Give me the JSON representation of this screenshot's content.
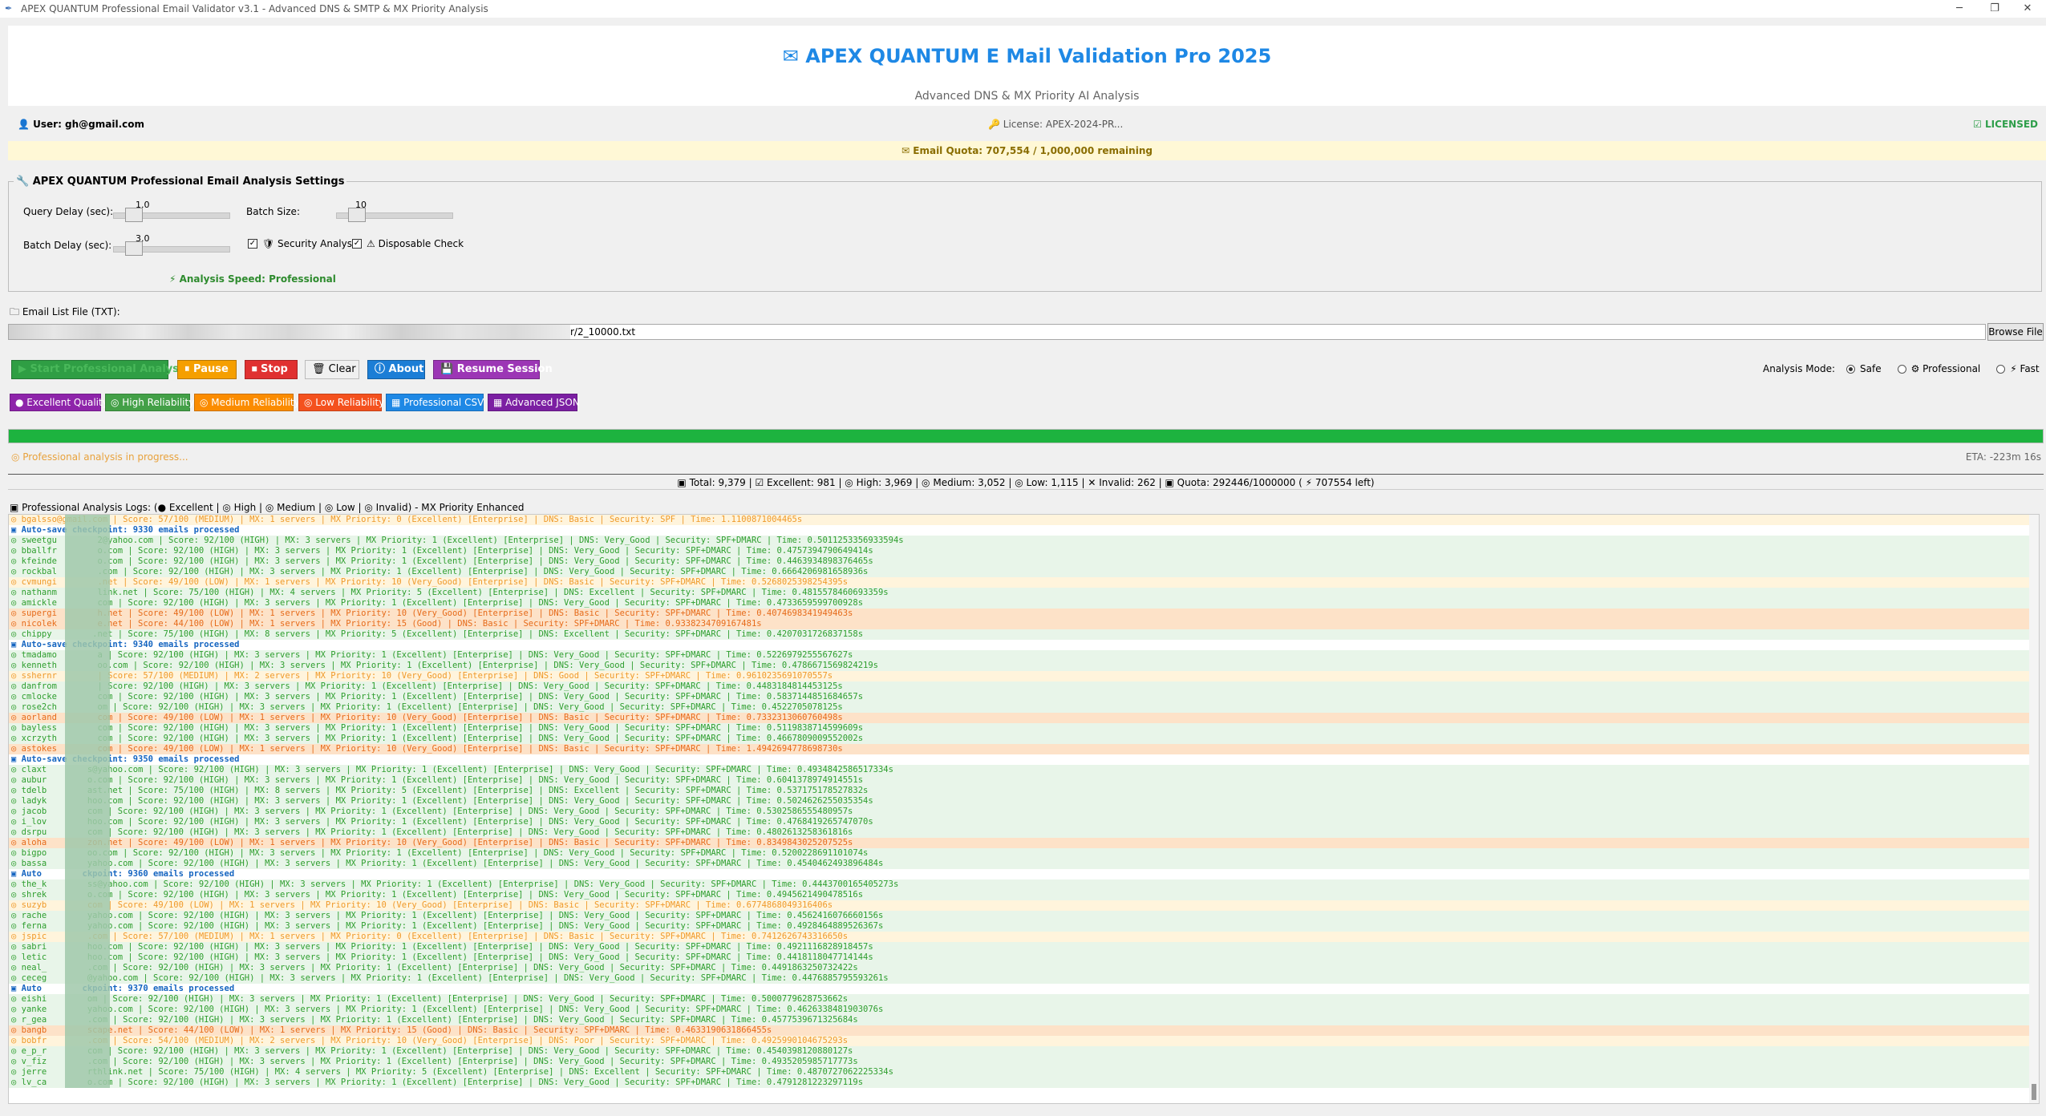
{
  "window": {
    "title": "APEX QUANTUM Professional Email Validator v3.1 - Advanced DNS & SMTP & MX Priority Analysis",
    "minimize": "─",
    "maximize": "❐",
    "close": "✕"
  },
  "header": {
    "title": "✉ APEX QUANTUM E Mail Validation Pro 2025",
    "subtitle": "Advanced DNS & MX Priority AI Analysis"
  },
  "userbar": {
    "user": "👤 User: gh@gmail.com",
    "license": "🔑 License: APEX-2024-PR...",
    "licensed": "☑ LICENSED"
  },
  "quota_bar": "✉ Email Quota: 707,554 / 1,000,000 remaining",
  "settings": {
    "title": "🔧 APEX QUANTUM Professional Email Analysis Settings",
    "query_delay_label": "Query Delay (sec):",
    "query_delay_value": "1.0",
    "query_delay_level": 0.09,
    "batch_size_label": "Batch Size:",
    "batch_size_value": "10",
    "batch_size_level": 0.09,
    "batch_delay_label": "Batch Delay (sec):",
    "batch_delay_value": "3.0",
    "batch_delay_level": 0.09,
    "security_analysis": "🛡 Security Analysis",
    "security_analysis_checked": true,
    "disposable_check": "⚠ Disposable Check",
    "disposable_check_checked": true,
    "analysis_speed": "⚡ Analysis Speed: Professional"
  },
  "file": {
    "label": "🗀 Email List File (TXT):",
    "path": "r/2_10000.txt",
    "browse": "Browse File"
  },
  "buttons": {
    "start": "▶ Start Professional Analysis",
    "pause": "⏸ Pause",
    "stop": "⏹ Stop",
    "clear": "🗑 Clear",
    "about": "ⓘ About",
    "resume": "💾 Resume Session"
  },
  "export_buttons": {
    "excellent": "● Excellent Quality",
    "high": "◎ High Reliability",
    "medium": "◎ Medium Reliability",
    "low": "◎ Low Reliability",
    "csv": "▦ Professional CSV",
    "json": "▦ Advanced JSON"
  },
  "mode": {
    "label": "Analysis Mode:",
    "safe": "Safe",
    "professional": "⚙ Professional",
    "fast": "⚡ Fast",
    "selected": "safe"
  },
  "progress": {
    "fraction": 1.0,
    "status": "◎ Professional analysis in progress...",
    "eta": "ETA: -223m 16s"
  },
  "stats": "▣ Total: 9,379 | ☑ Excellent: 981 | ◎ High: 3,969 | ◎ Medium: 3,052 | ◎ Low: 1,115 | ✕ Invalid: 262 | ▣ Quota: 292446/1000000 ( ⚡ 707554 left)",
  "logs": {
    "title": "▣ Professional Analysis Logs: (● Excellent | ◎ High | ◎ Medium | ◎ Low | ◎ Invalid) - MX Priority Enhanced",
    "lines": [
      {
        "t": "medium",
        "s": "◎ bgalsso@gmail.com | Score: 57/100 (MEDIUM) | MX: 1 servers | MX Priority: 0 (Excellent) [Enterprise] | DNS: Basic | Security: SPF | Time: 1.1100871004465s"
      },
      {
        "t": "cp",
        "s": "▣ Auto-save checkpoint: 9330 emails processed"
      },
      {
        "t": "high",
        "s": "◎ sweetgu        2@yahoo.com | Score: 92/100 (HIGH) | MX: 3 servers | MX Priority: 1 (Excellent) [Enterprise] | DNS: Very_Good | Security: SPF+DMARC | Time: 0.5011253356933594s"
      },
      {
        "t": "high",
        "s": "◎ bballfr        o.com | Score: 92/100 (HIGH) | MX: 3 servers | MX Priority: 1 (Excellent) [Enterprise] | DNS: Very_Good | Security: SPF+DMARC | Time: 0.4757394790649414s"
      },
      {
        "t": "high",
        "s": "◎ kfeinde        o.com | Score: 92/100 (HIGH) | MX: 3 servers | MX Priority: 1 (Excellent) [Enterprise] | DNS: Very_Good | Security: SPF+DMARC | Time: 0.4463934898376465s"
      },
      {
        "t": "high",
        "s": "◎ rockbal        .com | Score: 92/100 (HIGH) | MX: 3 servers | MX Priority: 1 (Excellent) [Enterprise] | DNS: Very_Good | Security: SPF+DMARC | Time: 0.6664206981658936s"
      },
      {
        "t": "medium",
        "s": "◎ cvmungi        .net | Score: 49/100 (LOW) | MX: 1 servers | MX Priority: 10 (Very_Good) [Enterprise] | DNS: Basic | Security: SPF+DMARC | Time: 0.5268025398254395s"
      },
      {
        "t": "high",
        "s": "◎ nathanm        link.net | Score: 75/100 (HIGH) | MX: 4 servers | MX Priority: 5 (Excellent) [Enterprise] | DNS: Excellent | Security: SPF+DMARC | Time: 0.4815578460693359s"
      },
      {
        "t": "high",
        "s": "◎ amickle        com | Score: 92/100 (HIGH) | MX: 3 servers | MX Priority: 1 (Excellent) [Enterprise] | DNS: Very_Good | Security: SPF+DMARC | Time: 0.4733659599700928s"
      },
      {
        "t": "low",
        "s": "◎ supergi        h.net | Score: 49/100 (LOW) | MX: 1 servers | MX Priority: 10 (Very_Good) [Enterprise] | DNS: Basic | Security: SPF+DMARC | Time: 0.4074698341949463s"
      },
      {
        "t": "low",
        "s": "◎ nicolek        e.net | Score: 44/100 (LOW) | MX: 1 servers | MX Priority: 15 (Good) | DNS: Basic | Security: SPF+DMARC | Time: 0.9338234709167481s"
      },
      {
        "t": "high",
        "s": "◎ chippy        .net | Score: 75/100 (HIGH) | MX: 8 servers | MX Priority: 5 (Excellent) [Enterprise] | DNS: Excellent | Security: SPF+DMARC | Time: 0.4207031726837158s"
      },
      {
        "t": "cp",
        "s": "▣ Auto-save checkpoint: 9340 emails processed"
      },
      {
        "t": "high",
        "s": "◎ tmadamo        a | Score: 92/100 (HIGH) | MX: 3 servers | MX Priority: 1 (Excellent) [Enterprise] | DNS: Very_Good | Security: SPF+DMARC | Time: 0.5226979255567627s"
      },
      {
        "t": "high",
        "s": "◎ kenneth        oo.com | Score: 92/100 (HIGH) | MX: 3 servers | MX Priority: 1 (Excellent) [Enterprise] | DNS: Very_Good | Security: SPF+DMARC | Time: 0.4786671569824219s"
      },
      {
        "t": "medium",
        "s": "◎ sshernr        | Score: 57/100 (MEDIUM) | MX: 2 servers | MX Priority: 10 (Very_Good) [Enterprise] | DNS: Good | Security: SPF+DMARC | Time: 0.9610235691070557s"
      },
      {
        "t": "high",
        "s": "◎ danfrom        | Score: 92/100 (HIGH) | MX: 3 servers | MX Priority: 1 (Excellent) [Enterprise] | DNS: Very_Good | Security: SPF+DMARC | Time: 0.4483184814453125s"
      },
      {
        "t": "high",
        "s": "◎ cmlocke        com | Score: 92/100 (HIGH) | MX: 3 servers | MX Priority: 1 (Excellent) [Enterprise] | DNS: Very_Good | Security: SPF+DMARC | Time: 0.5837144851684657s"
      },
      {
        "t": "high",
        "s": "◎ rose2ch        om | Score: 92/100 (HIGH) | MX: 3 servers | MX Priority: 1 (Excellent) [Enterprise] | DNS: Very_Good | Security: SPF+DMARC | Time: 0.4522705078125s"
      },
      {
        "t": "low",
        "s": "◎ aorland        com | Score: 49/100 (LOW) | MX: 1 servers | MX Priority: 10 (Very_Good) [Enterprise] | DNS: Basic | Security: SPF+DMARC | Time: 0.7332313060760498s"
      },
      {
        "t": "high",
        "s": "◎ bayless        com | Score: 92/100 (HIGH) | MX: 3 servers | MX Priority: 1 (Excellent) [Enterprise] | DNS: Very_Good | Security: SPF+DMARC | Time: 0.5119838714599609s"
      },
      {
        "t": "high",
        "s": "◎ xcrzyth        com | Score: 92/100 (HIGH) | MX: 3 servers | MX Priority: 1 (Excellent) [Enterprise] | DNS: Very_Good | Security: SPF+DMARC | Time: 0.4667809009552002s"
      },
      {
        "t": "low",
        "s": "◎ astokes        com | Score: 49/100 (LOW) | MX: 1 servers | MX Priority: 10 (Very_Good) [Enterprise] | DNS: Basic | Security: SPF+DMARC | Time: 1.4942694778698730s"
      },
      {
        "t": "cp",
        "s": "▣ Auto-save checkpoint: 9350 emails processed"
      },
      {
        "t": "high",
        "s": "◎ claxt        s@yahoo.com | Score: 92/100 (HIGH) | MX: 3 servers | MX Priority: 1 (Excellent) [Enterprise] | DNS: Very_Good | Security: SPF+DMARC | Time: 0.4934842586517334s"
      },
      {
        "t": "high",
        "s": "◎ aubur        o.com | Score: 92/100 (HIGH) | MX: 3 servers | MX Priority: 1 (Excellent) [Enterprise] | DNS: Very_Good | Security: SPF+DMARC | Time: 0.6041378974914551s"
      },
      {
        "t": "high",
        "s": "◎ tdelb        ast.net | Score: 75/100 (HIGH) | MX: 8 servers | MX Priority: 5 (Excellent) [Enterprise] | DNS: Excellent | Security: SPF+DMARC | Time: 0.537175178527832s"
      },
      {
        "t": "high",
        "s": "◎ ladyk        hoo.com | Score: 92/100 (HIGH) | MX: 3 servers | MX Priority: 1 (Excellent) [Enterprise] | DNS: Very_Good | Security: SPF+DMARC | Time: 0.5024626255035354s"
      },
      {
        "t": "high",
        "s": "◎ jacob        com | Score: 92/100 (HIGH) | MX: 3 servers | MX Priority: 1 (Excellent) [Enterprise] | DNS: Very_Good | Security: SPF+DMARC | Time: 0.5302586555480957s"
      },
      {
        "t": "high",
        "s": "◎ i_lov        hoo.com | Score: 92/100 (HIGH) | MX: 3 servers | MX Priority: 1 (Excellent) [Enterprise] | DNS: Very_Good | Security: SPF+DMARC | Time: 0.4768419265747070s"
      },
      {
        "t": "high",
        "s": "◎ dsrpu        com | Score: 92/100 (HIGH) | MX: 3 servers | MX Priority: 1 (Excellent) [Enterprise] | DNS: Very_Good | Security: SPF+DMARC | Time: 0.4802613258361816s"
      },
      {
        "t": "low",
        "s": "◎ aloha        zon.net | Score: 49/100 (LOW) | MX: 1 servers | MX Priority: 10 (Very_Good) [Enterprise] | DNS: Basic | Security: SPF+DMARC | Time: 0.8349843025207525s"
      },
      {
        "t": "high",
        "s": "◎ bigpo        oo.com | Score: 92/100 (HIGH) | MX: 3 servers | MX Priority: 1 (Excellent) [Enterprise] | DNS: Very_Good | Security: SPF+DMARC | Time: 0.5200228691101074s"
      },
      {
        "t": "high",
        "s": "◎ bassa        yahoo.com | Score: 92/100 (HIGH) | MX: 3 servers | MX Priority: 1 (Excellent) [Enterprise] | DNS: Very_Good | Security: SPF+DMARC | Time: 0.4540462493896484s"
      },
      {
        "t": "cp",
        "s": "▣ Auto        ckpoint: 9360 emails processed"
      },
      {
        "t": "high",
        "s": "◎ the_k        ss@yahoo.com | Score: 92/100 (HIGH) | MX: 3 servers | MX Priority: 1 (Excellent) [Enterprise] | DNS: Very_Good | Security: SPF+DMARC | Time: 0.4443700165405273s"
      },
      {
        "t": "high",
        "s": "◎ shrek        o.com | Score: 92/100 (HIGH) | MX: 3 servers | MX Priority: 1 (Excellent) [Enterprise] | DNS: Very_Good | Security: SPF+DMARC | Time: 0.4945621490478516s"
      },
      {
        "t": "medium",
        "s": "◎ suzyb        com | Score: 49/100 (LOW) | MX: 1 servers | MX Priority: 10 (Very_Good) [Enterprise] | DNS: Basic | Security: SPF+DMARC | Time: 0.6774868049316406s"
      },
      {
        "t": "high",
        "s": "◎ rache        yahoo.com | Score: 92/100 (HIGH) | MX: 3 servers | MX Priority: 1 (Excellent) [Enterprise] | DNS: Very_Good | Security: SPF+DMARC | Time: 0.4562416076660156s"
      },
      {
        "t": "high",
        "s": "◎ ferna        yahoo.com | Score: 92/100 (HIGH) | MX: 3 servers | MX Priority: 1 (Excellent) [Enterprise] | DNS: Very_Good | Security: SPF+DMARC | Time: 0.4928464889526367s"
      },
      {
        "t": "medium",
        "s": "◎ jspic        .com | Score: 57/100 (MEDIUM) | MX: 1 servers | MX Priority: 0 (Excellent) [Enterprise] | DNS: Basic | Security: SPF+DMARC | Time: 0.7412626743316650s"
      },
      {
        "t": "high",
        "s": "◎ sabri        hoo.com | Score: 92/100 (HIGH) | MX: 3 servers | MX Priority: 1 (Excellent) [Enterprise] | DNS: Very_Good | Security: SPF+DMARC | Time: 0.4921116828918457s"
      },
      {
        "t": "high",
        "s": "◎ letic        hoo.com | Score: 92/100 (HIGH) | MX: 3 servers | MX Priority: 1 (Excellent) [Enterprise] | DNS: Very_Good | Security: SPF+DMARC | Time: 0.4418118047714144s"
      },
      {
        "t": "high",
        "s": "◎ neal_        .com | Score: 92/100 (HIGH) | MX: 3 servers | MX Priority: 1 (Excellent) [Enterprise] | DNS: Very_Good | Security: SPF+DMARC | Time: 0.4491863250732422s"
      },
      {
        "t": "high",
        "s": "◎ ceceg        @yahoo.com | Score: 92/100 (HIGH) | MX: 3 servers | MX Priority: 1 (Excellent) [Enterprise] | DNS: Very_Good | Security: SPF+DMARC | Time: 0.4476885795593261s"
      },
      {
        "t": "cp",
        "s": "▣ Auto        ckpoint: 9370 emails processed"
      },
      {
        "t": "high",
        "s": "◎ eishi        om | Score: 92/100 (HIGH) | MX: 3 servers | MX Priority: 1 (Excellent) [Enterprise] | DNS: Very_Good | Security: SPF+DMARC | Time: 0.5000779628753662s"
      },
      {
        "t": "high",
        "s": "◎ yanke        yahoo.com | Score: 92/100 (HIGH) | MX: 3 servers | MX Priority: 1 (Excellent) [Enterprise] | DNS: Very_Good | Security: SPF+DMARC | Time: 0.4626338481903076s"
      },
      {
        "t": "high",
        "s": "◎ r_gea        .com | Score: 92/100 (HIGH) | MX: 3 servers | MX Priority: 1 (Excellent) [Enterprise] | DNS: Very_Good | Security: SPF+DMARC | Time: 0.4577539671325684s"
      },
      {
        "t": "low",
        "s": "◎ bangb        scape.net | Score: 44/100 (LOW) | MX: 1 servers | MX Priority: 15 (Good) | DNS: Basic | Security: SPF+DMARC | Time: 0.4633190631866455s"
      },
      {
        "t": "medium",
        "s": "◎ bobfr        .com | Score: 54/100 (MEDIUM) | MX: 2 servers | MX Priority: 10 (Very_Good) [Enterprise] | DNS: Poor | Security: SPF+DMARC | Time: 0.4925990104675293s"
      },
      {
        "t": "high",
        "s": "◎ e_p_r        com | Score: 92/100 (HIGH) | MX: 3 servers | MX Priority: 1 (Excellent) [Enterprise] | DNS: Very_Good | Security: SPF+DMARC | Time: 0.4540398120880127s"
      },
      {
        "t": "high",
        "s": "◎ v_fiz        .com | Score: 92/100 (HIGH) | MX: 3 servers | MX Priority: 1 (Excellent) [Enterprise] | DNS: Very_Good | Security: SPF+DMARC | Time: 0.4935205985717773s"
      },
      {
        "t": "high",
        "s": "◎ jerre        rthlink.net | Score: 75/100 (HIGH) | MX: 4 servers | MX Priority: 5 (Excellent) [Enterprise] | DNS: Excellent | Security: SPF+DMARC | Time: 0.4870727062225334s"
      },
      {
        "t": "high",
        "s": "◎ lv_ca        o.com | Score: 92/100 (HIGH) | MX: 3 servers | MX Priority: 1 (Excellent) [Enterprise] | DNS: Very_Good | Security: SPF+DMARC | Time: 0.4791281223297119s"
      }
    ]
  },
  "colors": {
    "accent": "#1e88e5",
    "start": "#2f9e44",
    "pause": "#f59f00",
    "stop": "#e03131",
    "about": "#1c7ed6",
    "resume": "#9c36b5",
    "excellent": "#8e24aa",
    "high": "#43a047",
    "medium": "#fb8c00",
    "low": "#f4511e",
    "csv": "#1e88e5",
    "json": "#7b1fa2",
    "progress": "#1db33f"
  }
}
